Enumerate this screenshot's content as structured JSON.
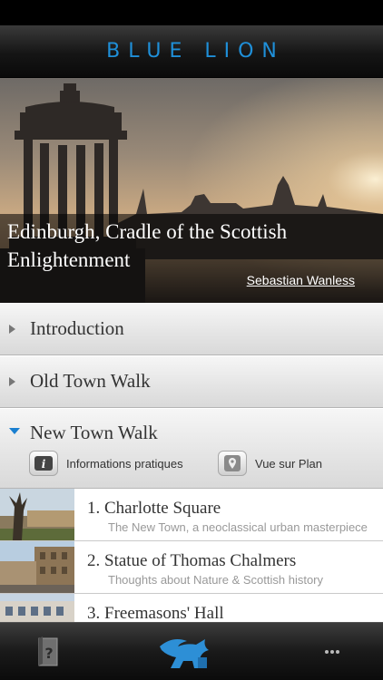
{
  "app": {
    "title": "BLUE LION"
  },
  "hero": {
    "title": "Edinburgh, Cradle of the Scottish Enlightenment",
    "credit": "Sebastian Wanless"
  },
  "sections": [
    {
      "label": "Introduction",
      "expanded": false
    },
    {
      "label": "Old Town Walk",
      "expanded": false
    },
    {
      "label": "New Town Walk",
      "expanded": true
    }
  ],
  "new_town_actions": {
    "info_label": "Informations pratiques",
    "map_label": "Vue sur Plan"
  },
  "stops": [
    {
      "title": "1. Charlotte Square",
      "subtitle": "The New Town, a neoclassical urban masterpiece"
    },
    {
      "title": "2. Statue of Thomas Chalmers",
      "subtitle": "Thoughts about Nature & Scottish history"
    },
    {
      "title": "3. Freemasons' Hall",
      "subtitle": ""
    }
  ],
  "tabbar": {
    "items": [
      {
        "icon": "guide-book-icon"
      },
      {
        "icon": "lion-logo-icon"
      },
      {
        "icon": "more-dots-icon"
      }
    ]
  },
  "colors": {
    "accent": "#1f8fd8"
  }
}
